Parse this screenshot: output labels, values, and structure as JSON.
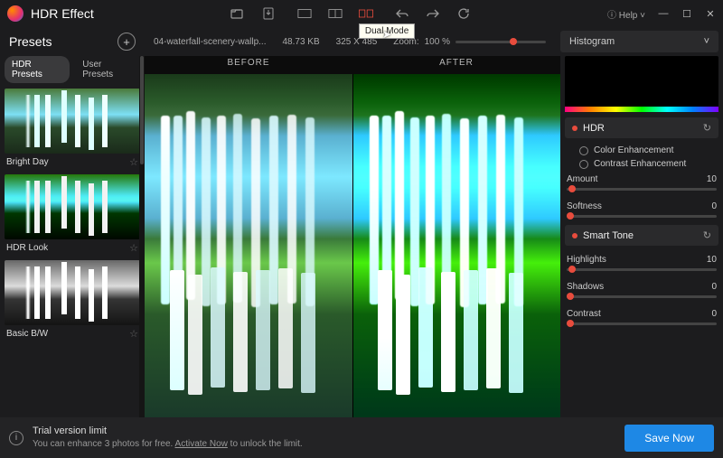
{
  "app": {
    "title": "HDR Effect",
    "help": "Help"
  },
  "toolbar": {
    "tooltip": "Dual Mode"
  },
  "presets": {
    "title": "Presets",
    "tabs": {
      "hdr": "HDR Presets",
      "user": "User Presets"
    },
    "items": [
      {
        "label": "Bright Day"
      },
      {
        "label": "HDR Look"
      },
      {
        "label": "Basic B/W"
      }
    ]
  },
  "fileinfo": {
    "name": "04-waterfall-scenery-wallp...",
    "size": "48.73 KB",
    "dims": "325 X 485",
    "zoom_label": "Zoom:",
    "zoom_value": "100 %"
  },
  "compare": {
    "before": "BEFORE",
    "after": "AFTER"
  },
  "right": {
    "histogram": "Histogram",
    "hdr": {
      "title": "HDR",
      "opt1": "Color Enhancement",
      "opt2": "Contrast Enhancement",
      "amount_label": "Amount",
      "amount_value": "10",
      "softness_label": "Softness",
      "softness_value": "0"
    },
    "smarttone": {
      "title": "Smart Tone",
      "highlights_label": "Highlights",
      "highlights_value": "10",
      "shadows_label": "Shadows",
      "shadows_value": "0",
      "contrast_label": "Contrast",
      "contrast_value": "0"
    }
  },
  "footer": {
    "title": "Trial version limit",
    "sub_pre": "You can enhance 3 photos for free. ",
    "activate": "Activate Now",
    "sub_post": " to unlock the limit.",
    "save": "Save Now"
  }
}
